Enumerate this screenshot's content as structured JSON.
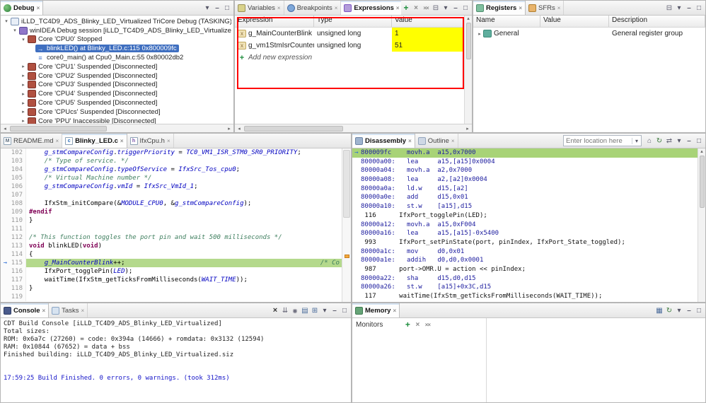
{
  "colors": {
    "selection_bg": "#3f6fc0",
    "changed_value_bg": "#ffff00",
    "exec_line_editor": "#b4d98c",
    "exec_line_disassembly": "#a8d377",
    "annotation": "#ff0000"
  },
  "debug": {
    "tabs": [
      {
        "label": "Debug",
        "icon": "debug",
        "active": true
      }
    ],
    "toolbar": [
      "view-menu",
      "minimize",
      "maximize"
    ],
    "tree": [
      {
        "level": 0,
        "expander": "open",
        "icon": "launch-config",
        "label": "iLLD_TC4D9_ADS_Blinky_LED_Virtualized TriCore Debug (TASKING) [TASKING winIDEA"
      },
      {
        "level": 1,
        "expander": "open",
        "icon": "debug-session",
        "label": "winIDEA Debug session [iLLD_TC4D9_ADS_Blinky_LED_Virtualized.elf from project"
      },
      {
        "level": 2,
        "expander": "open",
        "icon": "core",
        "label": "Core 'CPU0' Stopped"
      },
      {
        "level": 3,
        "expander": "leaf",
        "icon": "stack-frame-current",
        "label": "blinkLED() at Blinky_LED.c:115 0x800009fc",
        "selected": true
      },
      {
        "level": 3,
        "expander": "leaf",
        "icon": "stack-frame",
        "label": "core0_main() at Cpu0_Main.c:55 0x80002db2"
      },
      {
        "level": 2,
        "expander": "closed",
        "icon": "core",
        "label": "Core 'CPU1' Suspended [Disconnected]"
      },
      {
        "level": 2,
        "expander": "closed",
        "icon": "core",
        "label": "Core 'CPU2' Suspended [Disconnected]"
      },
      {
        "level": 2,
        "expander": "closed",
        "icon": "core",
        "label": "Core 'CPU3' Suspended [Disconnected]"
      },
      {
        "level": 2,
        "expander": "closed",
        "icon": "core",
        "label": "Core 'CPU4' Suspended [Disconnected]"
      },
      {
        "level": 2,
        "expander": "closed",
        "icon": "core",
        "label": "Core 'CPU5' Suspended [Disconnected]"
      },
      {
        "level": 2,
        "expander": "closed",
        "icon": "core",
        "label": "Core 'CPUcs' Suspended [Disconnected]"
      },
      {
        "level": 2,
        "expander": "closed",
        "icon": "core",
        "label": "Core 'PPU' Inaccessible [Disconnected]"
      }
    ]
  },
  "expressions": {
    "tabs": [
      {
        "label": "Variables",
        "icon": "variables"
      },
      {
        "label": "Breakpoints",
        "icon": "breakpoints"
      },
      {
        "label": "Expressions",
        "icon": "expressions",
        "active": true
      }
    ],
    "toolbar": [
      "add",
      "remove",
      "remove-all",
      "collapse-all",
      "view-menu",
      "minimize",
      "maximize"
    ],
    "columns": [
      "Expression",
      "Type",
      "Value"
    ],
    "rows": [
      {
        "expression": "g_MainCounterBlink",
        "type": "unsigned long",
        "value": "1",
        "changed": true
      },
      {
        "expression": "g_vm1StmIsrCounter",
        "type": "unsigned long",
        "value": "51",
        "changed": true
      }
    ],
    "add_row_label": "Add new expression"
  },
  "registers": {
    "tabs": [
      {
        "label": "Registers",
        "icon": "registers",
        "active": true
      },
      {
        "label": "SFRs",
        "icon": "sfrs"
      }
    ],
    "toolbar": [
      "collapse-all",
      "view-menu",
      "minimize",
      "maximize"
    ],
    "columns": [
      "Name",
      "Value",
      "Description"
    ],
    "rows": [
      {
        "name": "General",
        "value": "",
        "description": "General register group"
      }
    ]
  },
  "editor": {
    "tabs": [
      {
        "label": "README.md",
        "icon": "file-md"
      },
      {
        "label": "Blinky_LED.c",
        "icon": "file-c",
        "active": true
      },
      {
        "label": "IfxCpu.h",
        "icon": "file-h"
      }
    ],
    "lines": [
      {
        "n": "102",
        "segs": [
          [
            "    ",
            "t"
          ],
          [
            "g_stmCompareConfig",
            "m"
          ],
          [
            ".",
            "t"
          ],
          [
            "triggerPriority",
            "m"
          ],
          [
            " = ",
            "t"
          ],
          [
            "TC0_VM1_ISR_STM0_SR0_PRIORITY",
            "m"
          ],
          [
            ";",
            "t"
          ]
        ]
      },
      {
        "n": "103",
        "segs": [
          [
            "    ",
            "t"
          ],
          [
            "/* Type of service. */",
            "c"
          ]
        ]
      },
      {
        "n": "104",
        "segs": [
          [
            "    ",
            "t"
          ],
          [
            "g_stmCompareConfig",
            "m"
          ],
          [
            ".",
            "t"
          ],
          [
            "typeOfService",
            "m"
          ],
          [
            " = ",
            "t"
          ],
          [
            "IfxSrc_Tos_cpu0",
            "m"
          ],
          [
            ";",
            "t"
          ]
        ]
      },
      {
        "n": "105",
        "segs": [
          [
            "    ",
            "t"
          ],
          [
            "/* Virtual Machine number */",
            "c"
          ]
        ]
      },
      {
        "n": "106",
        "segs": [
          [
            "    ",
            "t"
          ],
          [
            "g_stmCompareConfig",
            "m"
          ],
          [
            ".",
            "t"
          ],
          [
            "vmId",
            "m"
          ],
          [
            " = ",
            "t"
          ],
          [
            "IfxSrc_VmId_1",
            "m"
          ],
          [
            ";",
            "t"
          ]
        ]
      },
      {
        "n": "107",
        "segs": []
      },
      {
        "n": "108",
        "segs": [
          [
            "    ",
            "t"
          ],
          [
            "IfxStm_initCompare",
            "t"
          ],
          [
            "(&",
            "t"
          ],
          [
            "MODULE_CPU0",
            "m"
          ],
          [
            ", &",
            "t"
          ],
          [
            "g_stmCompareConfig",
            "m"
          ],
          [
            ");",
            "t"
          ]
        ]
      },
      {
        "n": "109",
        "segs": [
          [
            "#endif",
            "d"
          ]
        ]
      },
      {
        "n": "110",
        "segs": [
          [
            "}",
            "t"
          ]
        ]
      },
      {
        "n": "111",
        "segs": []
      },
      {
        "n": "112",
        "segs": [
          [
            "/* This function toggles the port pin and wait 500 milliseconds */",
            "c"
          ]
        ]
      },
      {
        "n": "113",
        "segs": [
          [
            "void",
            "k"
          ],
          [
            " blinkLED(",
            "t"
          ],
          [
            "void",
            "k"
          ],
          [
            ")",
            "t"
          ]
        ]
      },
      {
        "n": "114",
        "segs": [
          [
            "{",
            "t"
          ]
        ]
      },
      {
        "n": "115",
        "exec": true,
        "segs": [
          [
            "    ",
            "t"
          ],
          [
            "g_MainCounterBlink",
            "m"
          ],
          [
            "++;",
            "t"
          ],
          [
            "                                                   ",
            "t"
          ],
          [
            "/* Co",
            "c"
          ]
        ]
      },
      {
        "n": "116",
        "segs": [
          [
            "    ",
            "t"
          ],
          [
            "IfxPort_togglePin(",
            "t"
          ],
          [
            "LED",
            "m"
          ],
          [
            ");",
            "t"
          ],
          [
            "                                                       ",
            "t"
          ],
          [
            "/*",
            "c"
          ]
        ]
      },
      {
        "n": "117",
        "segs": [
          [
            "    ",
            "t"
          ],
          [
            "waitTime(IfxStm_getTicksFromMilliseconds(",
            "t"
          ],
          [
            "WAIT_TIME",
            "m"
          ],
          [
            "));",
            "t"
          ],
          [
            "                         ",
            "t"
          ],
          [
            "/*",
            "c"
          ]
        ]
      },
      {
        "n": "118",
        "segs": [
          [
            "}",
            "t"
          ]
        ]
      },
      {
        "n": "119",
        "segs": []
      }
    ]
  },
  "disassembly": {
    "tabs": [
      {
        "label": "Disassembly",
        "icon": "disassembly",
        "active": true
      },
      {
        "label": "Outline",
        "icon": "outline"
      }
    ],
    "location_placeholder": "Enter location here",
    "toolbar": [
      "home",
      "refresh",
      "sync",
      "view-menu",
      "minimize",
      "maximize"
    ],
    "lines": [
      {
        "kind": "instr",
        "current": true,
        "addr": "800009fc",
        "text": "movh.a  a15,0x7000"
      },
      {
        "kind": "instr",
        "addr": "80000a00:",
        "text": "lea     a15,[a15]0x0004"
      },
      {
        "kind": "instr",
        "addr": "80000a04:",
        "text": "movh.a  a2,0x7000"
      },
      {
        "kind": "instr",
        "addr": "80000a08:",
        "text": "lea     a2,[a2]0x0004"
      },
      {
        "kind": "instr",
        "addr": "80000a0a:",
        "text": "ld.w    d15,[a2]"
      },
      {
        "kind": "instr",
        "addr": "80000a0e:",
        "text": "add     d15,0x01"
      },
      {
        "kind": "instr",
        "addr": "80000a10:",
        "text": "st.w    [a15],d15"
      },
      {
        "kind": "source",
        "num": "116",
        "text": "IfxPort_togglePin(LED);"
      },
      {
        "kind": "instr",
        "addr": "80000a12:",
        "text": "movh.a  a15,0xF004"
      },
      {
        "kind": "instr",
        "addr": "80000a16:",
        "text": "lea     a15,[a15]-0x5400"
      },
      {
        "kind": "source",
        "num": "993",
        "text": "IfxPort_setPinState(port, pinIndex, IfxPort_State_toggled);"
      },
      {
        "kind": "instr",
        "addr": "80000a1c:",
        "text": "mov     d0,0x01"
      },
      {
        "kind": "instr",
        "addr": "80000a1e:",
        "text": "addih   d0,d0,0x0001"
      },
      {
        "kind": "source",
        "num": "987",
        "text": "port->OMR.U = action << pinIndex;"
      },
      {
        "kind": "instr",
        "addr": "80000a22:",
        "text": "sha     d15,d0,d15"
      },
      {
        "kind": "instr",
        "addr": "80000a26:",
        "text": "st.w    [a15]+0x3C,d15"
      },
      {
        "kind": "source",
        "num": "117",
        "text": "waitTime(IfxStm_getTicksFromMilliseconds(WAIT_TIME));"
      }
    ]
  },
  "console": {
    "tabs": [
      {
        "label": "Console",
        "icon": "console",
        "active": true
      },
      {
        "label": "Tasks",
        "icon": "tasks"
      }
    ],
    "toolbar": [
      "clear",
      "scroll-lock",
      "pin",
      "console-select",
      "open-console",
      "view-menu",
      "minimize",
      "maximize"
    ],
    "lines": [
      {
        "text": "CDT Build Console [iLLD_TC4D9_ADS_Blinky_LED_Virtualized]"
      },
      {
        "text": "Total sizes:"
      },
      {
        "text": "ROM: 0x6a7c (27260) = code: 0x394a (14666) + romdata: 0x3132 (12594)"
      },
      {
        "text": "RAM: 0x10844 (67652) = data + bss"
      },
      {
        "text": "Finished building: iLLD_TC4D9_ADS_Blinky_LED_Virtualized.siz"
      },
      {
        "text": ""
      },
      {
        "text": ""
      },
      {
        "text": "17:59:25 Build Finished. 0 errors, 0 warnings. (took 312ms)",
        "style": "info-blue"
      }
    ]
  },
  "memory": {
    "tabs": [
      {
        "label": "Memory",
        "icon": "memory",
        "active": true
      }
    ],
    "toolbar": [
      "table",
      "refresh",
      "view-menu",
      "minimize",
      "maximize"
    ],
    "monitors_label": "Monitors",
    "monitors_toolbar": [
      "add",
      "remove",
      "remove-all"
    ]
  }
}
